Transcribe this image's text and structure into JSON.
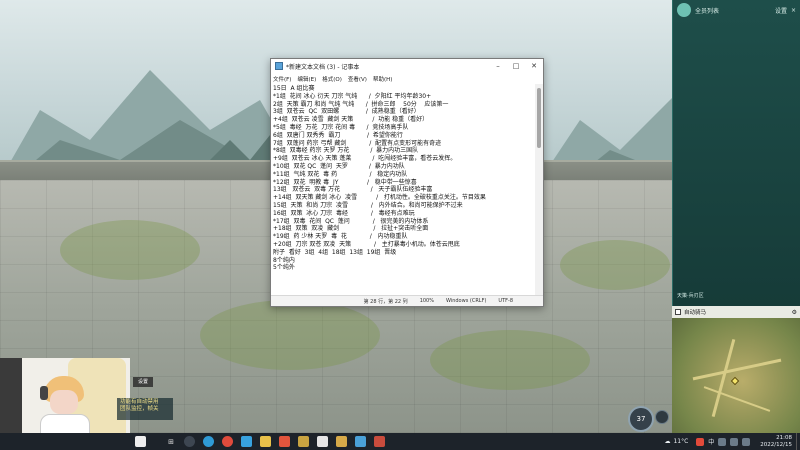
{
  "notepad": {
    "title": "*新建文本文档 (3) - 记事本",
    "menu": [
      "文件(F)",
      "编辑(E)",
      "格式(O)",
      "查看(V)",
      "帮助(H)"
    ],
    "lines": [
      "15日  A 组比赛",
      "*1组  花间 冰心 衍天 刀宗 气纯      /  夕阳红 平均年龄30+",
      "2组  天策 霸刀 和尚 气纯 气纯      /  拼命三郎    50分    应该第一",
      "3组  双苍云  QC  双田螺              /  成熟稳重（看好）",
      "+4组  双苍云 凌雪  藏剑 天策          /  功能 稳重（看好）",
      "*5组  毒经  万花  刀宗 花间 毒      /  竞技场高手队",
      "6组  双唐门 双秀秀  霸刀              /  希望你能行",
      "7组  双蓬问 药宗 弓帮 藏剑            /  配置有点变形可能有奇迹",
      "*8组  双毒经 药宗 天罗 万花           /  暴力内功三国队",
      "+9组  双苍云 冰心 天策 蓬莱           /  吃闯经验丰富，看苍云发挥。",
      "*10组  双花 QC  蓬问  天罗           /  暴力内功队",
      "*11组  气纯 双花  毒 药                 /   稳定内功队",
      "*12组  双花  明教 毒  JY               /   稳中带一些惊喜",
      "13组   双苍云  双毒 万花                /   天子霸队伍经验丰富",
      "+14组  双天策 藏剑 冰心  凌雪          /   打机动性。全破枝重点关注。节目效果",
      "15组  天策  和尚 刀宗  凌雪            /   内外结合。和尚可能保护不过来",
      "16组  双策  冰心 刀宗  毒经            /   毒经有点难玩",
      "*17组  双毒  花间  QC  蓬问            /   很完美的内功体系",
      "+18组  双策  双凌  藏剑                  /   拉扯+突击听全面",
      "*19组  药 少林 天罗  毒  花            /   内功稳重队",
      "+20组  刀宗 双苍 双凌  天策            /   主打暴毒小机动。体苍云甩底",
      "附子  看好  3组  4组  18组  13组  19组  晋级",
      "8个纯内",
      "5个纯外"
    ],
    "status": {
      "position": "第 28 行，第 22 列",
      "zoom": "100%",
      "line_ending": "Windows (CRLF)",
      "encoding": "UTF-8"
    }
  },
  "right_panel": {
    "title": "全员列表",
    "buttons": [
      "设置",
      "×"
    ],
    "tag": "天策·兵刃区"
  },
  "minimap": {
    "auto_mount_label": "自动骑马",
    "gear": "⚙"
  },
  "subtitle": {
    "header": "设置",
    "lines": [
      "功能有自动禁用",
      "团队监控，帧关"
    ]
  },
  "hud": {
    "value": "37"
  },
  "taskbar": {
    "weather": "11°C",
    "input_lang": "中",
    "time": "21:08",
    "date": "2022/12/15"
  },
  "colors": {
    "panel_teal": "#1e4e4a",
    "taskbar": "#1d232a",
    "subtitle_text": "#f3e28a"
  },
  "icons": [
    "start-icon",
    "search-icon",
    "edge-icon",
    "folder-icon",
    "store-icon",
    "app-icon",
    "weather-icon",
    "speaker-icon",
    "network-icon",
    "gear-icon"
  ]
}
